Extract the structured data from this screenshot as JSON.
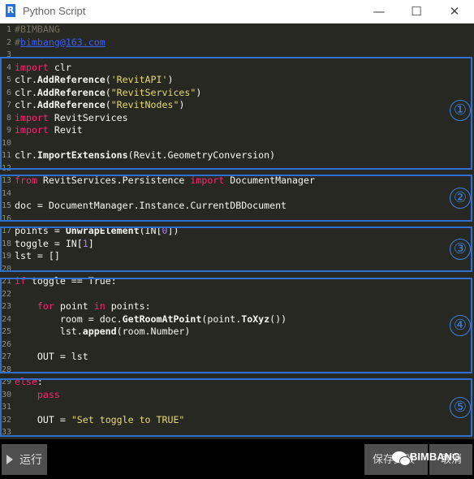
{
  "window": {
    "title": "Python Script",
    "app_icon_letter": "R",
    "minimize_glyph": "—",
    "maximize_glyph": "☐",
    "close_glyph": "✕"
  },
  "code_lines": [
    {
      "num": "1",
      "parts": [
        {
          "t": "#BIMBANG",
          "c": "cm"
        }
      ]
    },
    {
      "num": "2",
      "parts": [
        {
          "t": "#",
          "c": "cm"
        },
        {
          "t": "bimbang@163.com",
          "c": "link"
        }
      ]
    },
    {
      "num": "3",
      "parts": []
    },
    {
      "num": "4",
      "parts": [
        {
          "t": "import",
          "c": "kw"
        },
        {
          "t": " clr",
          "c": ""
        }
      ]
    },
    {
      "num": "5",
      "parts": [
        {
          "t": "clr.",
          "c": ""
        },
        {
          "t": "AddReference",
          "c": "fn"
        },
        {
          "t": "(",
          "c": ""
        },
        {
          "t": "'RevitAPI'",
          "c": "str"
        },
        {
          "t": ")",
          "c": ""
        }
      ]
    },
    {
      "num": "6",
      "parts": [
        {
          "t": "clr.",
          "c": ""
        },
        {
          "t": "AddReference",
          "c": "fn"
        },
        {
          "t": "(",
          "c": ""
        },
        {
          "t": "\"RevitServices\"",
          "c": "str"
        },
        {
          "t": ")",
          "c": ""
        }
      ]
    },
    {
      "num": "7",
      "parts": [
        {
          "t": "clr.",
          "c": ""
        },
        {
          "t": "AddReference",
          "c": "fn"
        },
        {
          "t": "(",
          "c": ""
        },
        {
          "t": "\"RevitNodes\"",
          "c": "str"
        },
        {
          "t": ")",
          "c": ""
        }
      ]
    },
    {
      "num": "8",
      "parts": [
        {
          "t": "import",
          "c": "kw"
        },
        {
          "t": " RevitServices",
          "c": ""
        }
      ]
    },
    {
      "num": "9",
      "parts": [
        {
          "t": "import",
          "c": "kw"
        },
        {
          "t": " Revit",
          "c": ""
        }
      ]
    },
    {
      "num": "10",
      "parts": []
    },
    {
      "num": "11",
      "parts": [
        {
          "t": "clr.",
          "c": ""
        },
        {
          "t": "ImportExtensions",
          "c": "fn"
        },
        {
          "t": "(Revit.GeometryConversion)",
          "c": ""
        }
      ]
    },
    {
      "num": "12",
      "parts": []
    },
    {
      "num": "13",
      "parts": [
        {
          "t": "from",
          "c": "kw"
        },
        {
          "t": " RevitServices.Persistence ",
          "c": ""
        },
        {
          "t": "import",
          "c": "kw"
        },
        {
          "t": " DocumentManager",
          "c": ""
        }
      ]
    },
    {
      "num": "14",
      "parts": []
    },
    {
      "num": "15",
      "parts": [
        {
          "t": "doc = DocumentManager.Instance.CurrentDBDocument",
          "c": ""
        }
      ]
    },
    {
      "num": "16",
      "parts": []
    },
    {
      "num": "17",
      "parts": [
        {
          "t": "points = ",
          "c": ""
        },
        {
          "t": "UnwrapElement",
          "c": "fn"
        },
        {
          "t": "(IN[",
          "c": ""
        },
        {
          "t": "0",
          "c": "num"
        },
        {
          "t": "])",
          "c": ""
        }
      ]
    },
    {
      "num": "18",
      "parts": [
        {
          "t": "toggle = IN[",
          "c": ""
        },
        {
          "t": "1",
          "c": "num"
        },
        {
          "t": "]",
          "c": ""
        }
      ]
    },
    {
      "num": "19",
      "parts": [
        {
          "t": "lst = []",
          "c": ""
        }
      ]
    },
    {
      "num": "20",
      "parts": []
    },
    {
      "num": "21",
      "parts": [
        {
          "t": "if",
          "c": "kw"
        },
        {
          "t": " toggle == True:",
          "c": ""
        }
      ]
    },
    {
      "num": "22",
      "parts": []
    },
    {
      "num": "23",
      "parts": [
        {
          "t": "    ",
          "c": ""
        },
        {
          "t": "for",
          "c": "kw"
        },
        {
          "t": " point ",
          "c": ""
        },
        {
          "t": "in",
          "c": "kw"
        },
        {
          "t": " points:",
          "c": ""
        }
      ]
    },
    {
      "num": "24",
      "parts": [
        {
          "t": "        room = doc.",
          "c": ""
        },
        {
          "t": "GetRoomAtPoint",
          "c": "fn"
        },
        {
          "t": "(point.",
          "c": ""
        },
        {
          "t": "ToXyz",
          "c": "fn"
        },
        {
          "t": "())",
          "c": ""
        }
      ]
    },
    {
      "num": "25",
      "parts": [
        {
          "t": "        lst.",
          "c": ""
        },
        {
          "t": "append",
          "c": "fn"
        },
        {
          "t": "(room.Number)",
          "c": ""
        }
      ]
    },
    {
      "num": "26",
      "parts": []
    },
    {
      "num": "27",
      "parts": [
        {
          "t": "    OUT = lst",
          "c": ""
        }
      ]
    },
    {
      "num": "28",
      "parts": []
    },
    {
      "num": "29",
      "parts": [
        {
          "t": "else",
          "c": "kw"
        },
        {
          "t": ":",
          "c": ""
        }
      ]
    },
    {
      "num": "30",
      "parts": [
        {
          "t": "    ",
          "c": ""
        },
        {
          "t": "pass",
          "c": "kw"
        }
      ]
    },
    {
      "num": "31",
      "parts": []
    },
    {
      "num": "32",
      "parts": [
        {
          "t": "    OUT = ",
          "c": ""
        },
        {
          "t": "\"Set toggle to TRUE\"",
          "c": "str"
        }
      ]
    },
    {
      "num": "33",
      "parts": []
    }
  ],
  "annotations": [
    "①",
    "②",
    "③",
    "④",
    "⑤"
  ],
  "buttons": {
    "run": "运行",
    "save": "保存更改",
    "cancel": "取消"
  },
  "watermark": "BIMBANG",
  "colors": {
    "editor_bg": "#272822",
    "keyword": "#f92672",
    "string": "#e6db74",
    "number": "#ae81ff",
    "annotation_blue": "#2f6fcf"
  }
}
